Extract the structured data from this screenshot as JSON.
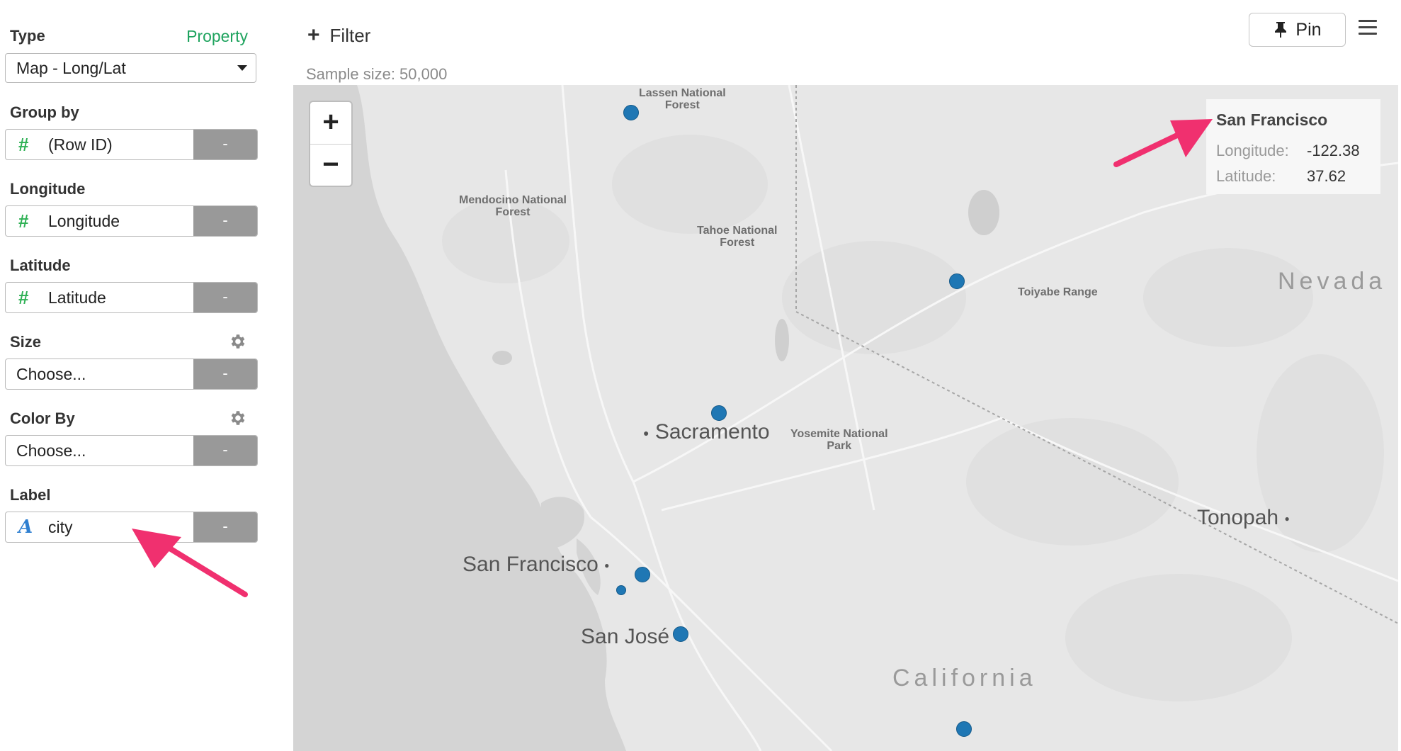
{
  "sidebar": {
    "type": {
      "label": "Type",
      "property_link": "Property",
      "value": "Map - Long/Lat"
    },
    "group_by": {
      "label": "Group by",
      "field": "(Row ID)",
      "remove": "-"
    },
    "longitude": {
      "label": "Longitude",
      "field": "Longitude",
      "remove": "-"
    },
    "latitude": {
      "label": "Latitude",
      "field": "Latitude",
      "remove": "-"
    },
    "size": {
      "label": "Size",
      "value": "Choose...",
      "remove": "-"
    },
    "color_by": {
      "label": "Color By",
      "value": "Choose...",
      "remove": "-"
    },
    "label": {
      "label": "Label",
      "field": "city",
      "remove": "-"
    }
  },
  "toolbar": {
    "filter_label": "Filter",
    "sample_size": "Sample size: 50,000",
    "pin_label": "Pin"
  },
  "map": {
    "zoom_in": "+",
    "zoom_out": "−",
    "places": {
      "lassen": "Lassen National\nForest",
      "mendocino": "Mendocino National\nForest",
      "tahoe": "Tahoe National\nForest",
      "yosemite": "Yosemite National\nPark",
      "toiyabe": "Toiyabe Range"
    },
    "cities": {
      "sacramento": "Sacramento",
      "san_francisco": "San Francisco",
      "san_jose": "San José",
      "tonopah": "Tonopah"
    },
    "regions": {
      "nevada": "Nevada",
      "california": "California"
    },
    "tooltip": {
      "title": "San Francisco",
      "longitude_label": "Longitude:",
      "longitude_value": "-122.38",
      "latitude_label": "Latitude:",
      "latitude_value": "37.62"
    }
  },
  "colors": {
    "accent_green": "#1ea35e",
    "marker_blue": "#1f77b4",
    "annotation_arrow": "#f0306f"
  }
}
